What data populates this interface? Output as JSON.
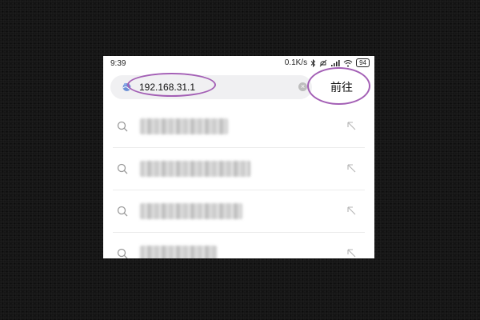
{
  "status_bar": {
    "time": "9:39",
    "network_speed": "0.1K/s",
    "battery": "94"
  },
  "address_bar": {
    "url": "192.168.31.1",
    "icons": [
      "globe-icon",
      "clear-icon"
    ]
  },
  "go_button": {
    "label": "前往"
  },
  "suggestions": [
    {
      "text": "██████████",
      "icon": "search-icon",
      "action_icon": "arrow-up-left-icon"
    },
    {
      "text": "█████████████",
      "icon": "search-icon",
      "action_icon": "arrow-up-left-icon"
    },
    {
      "text": "███████████",
      "icon": "search-icon",
      "action_icon": "arrow-up-left-icon"
    },
    {
      "text": "████████",
      "icon": "search-icon",
      "action_icon": "arrow-up-left-icon"
    }
  ],
  "colors": {
    "annotation": "#a35fb5",
    "search_bg": "#f0f0f2",
    "backdrop": "#151515"
  }
}
